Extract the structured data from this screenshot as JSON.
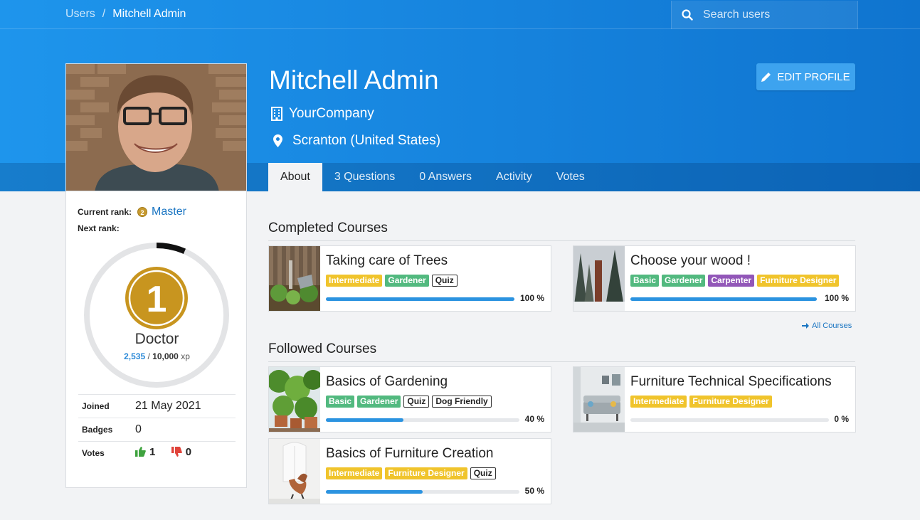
{
  "breadcrumb": {
    "users": "Users",
    "separator": "/",
    "current": "Mitchell Admin"
  },
  "search": {
    "placeholder": "Search users",
    "icon": "search-icon"
  },
  "profile": {
    "name": "Mitchell Admin",
    "company": "YourCompany",
    "location": "Scranton (United States)",
    "edit_button": "EDIT PROFILE"
  },
  "tabs": [
    "About",
    "3 Questions",
    "0 Answers",
    "Activity",
    "Votes"
  ],
  "sidebar": {
    "current_rank_label": "Current rank:",
    "current_rank_badge": "2",
    "current_rank": "Master",
    "next_rank_label": "Next rank:",
    "level_number": "1",
    "level_name": "Doctor",
    "xp_current": "2,535",
    "xp_separator": "/",
    "xp_max": "10,000",
    "xp_unit": "xp",
    "xp_progress": 0.2535,
    "joined_label": "Joined",
    "joined": "21 May 2021",
    "badges_label": "Badges",
    "badges": "0",
    "votes_label": "Votes",
    "votes_up": "1",
    "votes_down": "0"
  },
  "completed": {
    "title": "Completed Courses",
    "all_courses": "All Courses",
    "courses": [
      {
        "title": "Taking care of Trees",
        "percent": "100 %",
        "progress": 100,
        "tags": [
          {
            "label": "Intermediate",
            "style": "yellow"
          },
          {
            "label": "Gardener",
            "style": "green"
          },
          {
            "label": "Quiz",
            "style": "outline"
          }
        ]
      },
      {
        "title": "Choose your wood !",
        "percent": "100 %",
        "progress": 100,
        "tags": [
          {
            "label": "Basic",
            "style": "green"
          },
          {
            "label": "Gardener",
            "style": "green"
          },
          {
            "label": "Carpenter",
            "style": "purple"
          },
          {
            "label": "Furniture Designer",
            "style": "yellow"
          }
        ]
      }
    ]
  },
  "followed": {
    "title": "Followed Courses",
    "courses": [
      {
        "title": "Basics of Gardening",
        "percent": "40 %",
        "progress": 40,
        "tags": [
          {
            "label": "Basic",
            "style": "green"
          },
          {
            "label": "Gardener",
            "style": "green"
          },
          {
            "label": "Quiz",
            "style": "outline"
          },
          {
            "label": "Dog Friendly",
            "style": "outline"
          }
        ]
      },
      {
        "title": "Furniture Technical Specifications",
        "percent": "0 %",
        "progress": 0,
        "tags": [
          {
            "label": "Intermediate",
            "style": "yellow"
          },
          {
            "label": "Furniture Designer",
            "style": "yellow"
          }
        ]
      },
      {
        "title": "Basics of Furniture Creation",
        "percent": "50 %",
        "progress": 50,
        "tags": [
          {
            "label": "Intermediate",
            "style": "yellow"
          },
          {
            "label": "Furniture Designer",
            "style": "yellow"
          },
          {
            "label": "Quiz",
            "style": "outline"
          }
        ]
      }
    ]
  },
  "colors": {
    "primary": "#1683dd",
    "tag_yellow": "#f0c42c",
    "tag_green": "#52b97f",
    "tag_purple": "#9257b8",
    "progress": "#2b93e0"
  }
}
